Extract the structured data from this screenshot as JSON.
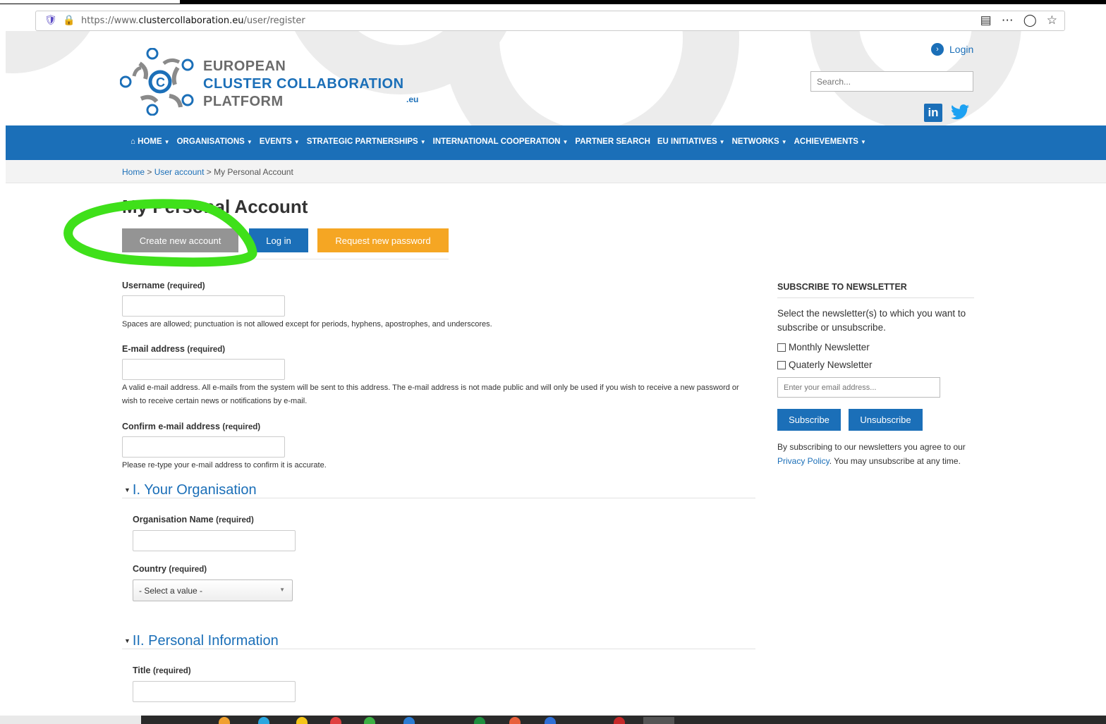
{
  "browser": {
    "url_prefix": "https://www.",
    "url_domain": "clustercollaboration.eu",
    "url_path": "/user/register"
  },
  "header": {
    "logo_line1": "EUROPEAN",
    "logo_line2": "CLUSTER COLLABORATION",
    "logo_line3": "PLATFORM",
    "logo_suffix": ".eu",
    "login_label": "Login",
    "search_placeholder": "Search...",
    "linkedin_label": "in"
  },
  "nav": {
    "items": [
      {
        "label": "HOME"
      },
      {
        "label": "ORGANISATIONS"
      },
      {
        "label": "EVENTS"
      },
      {
        "label": "STRATEGIC PARTNERSHIPS"
      },
      {
        "label": "INTERNATIONAL COOPERATION"
      },
      {
        "label": "PARTNER SEARCH"
      },
      {
        "label": "EU INITIATIVES"
      },
      {
        "label": "NETWORKS"
      },
      {
        "label": "ACHIEVEMENTS"
      }
    ]
  },
  "breadcrumb": {
    "home": "Home",
    "sep1": " > ",
    "user_account": "User account",
    "sep2": " > ",
    "current": "My Personal Account"
  },
  "page_title": "My Personal Account",
  "tabs": {
    "create": "Create new account",
    "login": "Log in",
    "request": "Request new password"
  },
  "form": {
    "username_label": "Username",
    "username_req": "(required)",
    "username_help": "Spaces are allowed; punctuation is not allowed except for periods, hyphens, apostrophes, and underscores.",
    "email_label": "E-mail address",
    "email_req": "(required)",
    "email_help": "A valid e-mail address. All e-mails from the system will be sent to this address. The e-mail address is not made public and will only be used if you wish to receive a new password or wish to receive certain news or notifications by e-mail.",
    "confirm_label": "Confirm e-mail address",
    "confirm_req": "(required)",
    "confirm_help": "Please re-type your e-mail address to confirm it is accurate.",
    "section1": "I. Your Organisation",
    "org_name_label": "Organisation Name",
    "org_name_req": "(required)",
    "country_label": "Country",
    "country_req": "(required)",
    "country_value": "- Select a value -",
    "section2": "II. Personal Information",
    "title_label": "Title",
    "title_req": "(required)"
  },
  "newsletter": {
    "title": "SUBSCRIBE TO NEWSLETTER",
    "description": "Select the newsletter(s) to which you want to subscribe or unsubscribe.",
    "option1": "Monthly Newsletter",
    "option2": "Quaterly Newsletter",
    "email_placeholder": "Enter your email address...",
    "subscribe": "Subscribe",
    "unsubscribe": "Unsubscribe",
    "policy_pre": "By subscribing to our newsletters you agree to our ",
    "policy_link": "Privacy Policy",
    "policy_post": ". You may unsubscribe at any time."
  },
  "colors": {
    "brand_blue": "#1b6fb8",
    "orange": "#f5a623",
    "gray_button": "#949494",
    "annotation_green": "#3fe01a"
  }
}
